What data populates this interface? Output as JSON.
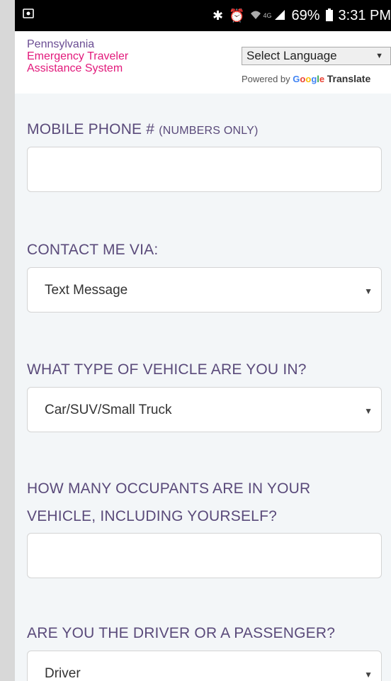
{
  "status_bar": {
    "battery": "69%",
    "time": "3:31 PM",
    "network": "4G"
  },
  "header": {
    "brand_line1": "Pennsylvania",
    "brand_line2": "Emergency Traveler",
    "brand_line3": "Assistance System",
    "language_select": "Select Language",
    "powered_by": "Powered by",
    "google": "Google",
    "translate": "Translate"
  },
  "form": {
    "mobile_label": "MOBILE PHONE #",
    "mobile_note": "(NUMBERS ONLY)",
    "mobile_value": "",
    "contact_label": "CONTACT ME VIA:",
    "contact_value": "Text Message",
    "vehicle_label": "WHAT TYPE OF VEHICLE ARE YOU IN?",
    "vehicle_value": "Car/SUV/Small Truck",
    "occupants_label_1": "HOW MANY OCCUPANTS ARE IN YOUR",
    "occupants_label_2": "VEHICLE, INCLUDING YOURSELF?",
    "occupants_value": "",
    "role_label": "ARE YOU THE DRIVER OR A PASSENGER?",
    "role_value": "Driver"
  },
  "colors": {
    "brand_purple": "#6a4c93",
    "brand_pink": "#e2197b",
    "label": "#5a4a7a",
    "page_bg": "#f3f6f8"
  }
}
